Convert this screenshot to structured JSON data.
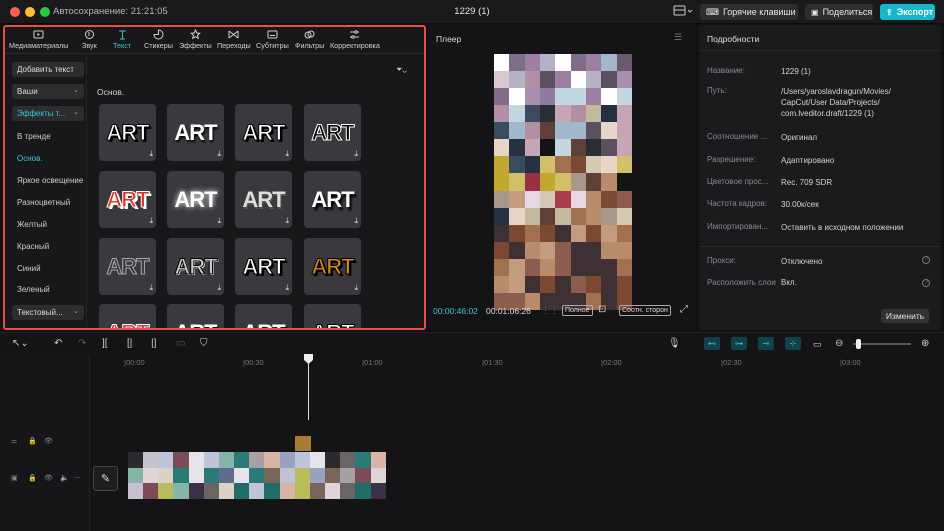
{
  "window": {
    "autosave": "Автосохранение: 21:21:05",
    "title": "1229 (1)",
    "hotkeys_label": "Горячие клавиши",
    "share_label": "Поделиться",
    "export_label": "Экспорт"
  },
  "tabs": [
    {
      "label": "Медиаматериалы",
      "icon": "media-icon"
    },
    {
      "label": "Звук",
      "icon": "audio-icon"
    },
    {
      "label": "Текст",
      "icon": "text-icon",
      "active": true
    },
    {
      "label": "Стикеры",
      "icon": "sticker-icon"
    },
    {
      "label": "Эффекты",
      "icon": "effects-icon"
    },
    {
      "label": "Переходы",
      "icon": "transitions-icon"
    },
    {
      "label": "Субтитры",
      "icon": "subtitles-icon"
    },
    {
      "label": "Фильтры",
      "icon": "filters-icon"
    },
    {
      "label": "Корректировка",
      "icon": "adjust-icon"
    }
  ],
  "categories": {
    "add_text": "Добавить текст",
    "yours": "Ваши",
    "effects": "Эффекты т...",
    "items": [
      "В тренде",
      "Основ.",
      "Яркое освещение",
      "Разноцветный",
      "Желтый",
      "Красный",
      "Синий",
      "Зеленый"
    ],
    "selected": "Основ.",
    "text_templates": "Текстовый..."
  },
  "section_label": "Основ.",
  "tiles": [
    {
      "text": "ART",
      "style": "white-outline"
    },
    {
      "text": "ART",
      "style": "white-shadow"
    },
    {
      "text": "ART",
      "style": "white-black"
    },
    {
      "text": "ART",
      "style": "black-white"
    },
    {
      "text": "ART",
      "style": "red-white"
    },
    {
      "text": "ART",
      "style": "glow"
    },
    {
      "text": "ART",
      "style": "silver"
    },
    {
      "text": "ART",
      "style": "white-dark-shadow"
    },
    {
      "text": "ART",
      "style": "gray-outline"
    },
    {
      "text": "ART",
      "style": "chrome"
    },
    {
      "text": "ART",
      "style": "white-thick"
    },
    {
      "text": "ART",
      "style": "gold-black"
    },
    {
      "text": "ART",
      "style": "pink-red"
    },
    {
      "text": "ART",
      "style": "white-bold"
    },
    {
      "text": "ART",
      "style": "white-3d"
    },
    {
      "text": "ART",
      "style": "white-box"
    }
  ],
  "player": {
    "title": "Плеер",
    "current_time": "00:00:46:02",
    "total_time": "00:01:06:26",
    "full_label": "Полное",
    "ratio_label": "Соотн. сторон"
  },
  "details": {
    "title": "Подробности",
    "rows": [
      {
        "label": "Название:",
        "value": "1229 (1)"
      },
      {
        "label": "Путь:",
        "value": "/Users/yaroslavdragun/Movies/ CapCut/User Data/Projects/ com.lveditor.draft/1229 (1)"
      },
      {
        "label": "Соотношение ...",
        "value": "Оригинал"
      },
      {
        "label": "Разрешение:",
        "value": "Адаптировано"
      },
      {
        "label": "Цветовое прос...",
        "value": "Rec. 709 SDR"
      },
      {
        "label": "Частота кадров:",
        "value": "30.00к/сек"
      },
      {
        "label": "Импортирован...",
        "value": "Оставить в исходном положении"
      },
      {
        "label": "Прокси:",
        "value": "Отключено"
      },
      {
        "label": "Расположить слои",
        "value": "Вкл."
      }
    ],
    "edit_label": "Изменить"
  },
  "timeline": {
    "ruler": [
      "|00:00",
      "|00:30",
      "|01:00",
      "|01:30",
      "|02:00",
      "|02:30",
      "|03:00"
    ]
  },
  "colors": {
    "accent": "#3ec5d8",
    "highlight_border": "#ea4d43",
    "export_bg": "#17b6cc"
  }
}
